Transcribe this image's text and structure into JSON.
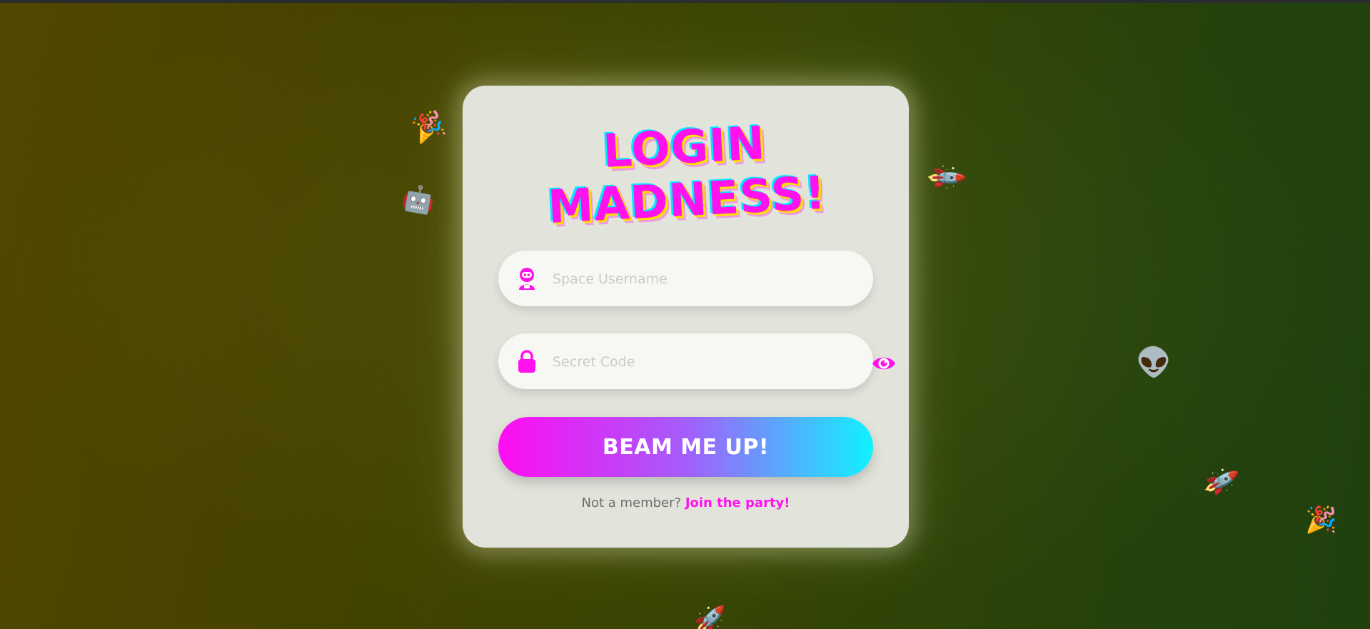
{
  "title": {
    "line1": "LOGIN",
    "line2": "MADNESS!"
  },
  "username": {
    "placeholder": "Space Username",
    "value": "",
    "icon": "astronaut-icon"
  },
  "password": {
    "placeholder": "Secret Code",
    "value": "",
    "icon": "lock-icon",
    "toggle_icon": "eye-icon"
  },
  "submit": {
    "label": "BEAM ME UP!"
  },
  "footer": {
    "prompt": "Not a member?",
    "link": "Join the party!"
  },
  "decorations": [
    {
      "name": "party-popper",
      "glyph": "🎉"
    },
    {
      "name": "robot",
      "glyph": "🤖"
    },
    {
      "name": "rocket",
      "glyph": "🚀"
    },
    {
      "name": "alien",
      "glyph": "👽"
    },
    {
      "name": "rocket",
      "glyph": "🚀"
    },
    {
      "name": "party-popper",
      "glyph": "🎉"
    },
    {
      "name": "rocket",
      "glyph": "🚀"
    }
  ],
  "colors": {
    "accent": "#ff12ee",
    "accent_cyan": "#10f2ff",
    "card": "#e2e4dc",
    "field": "#f7f8f4"
  }
}
